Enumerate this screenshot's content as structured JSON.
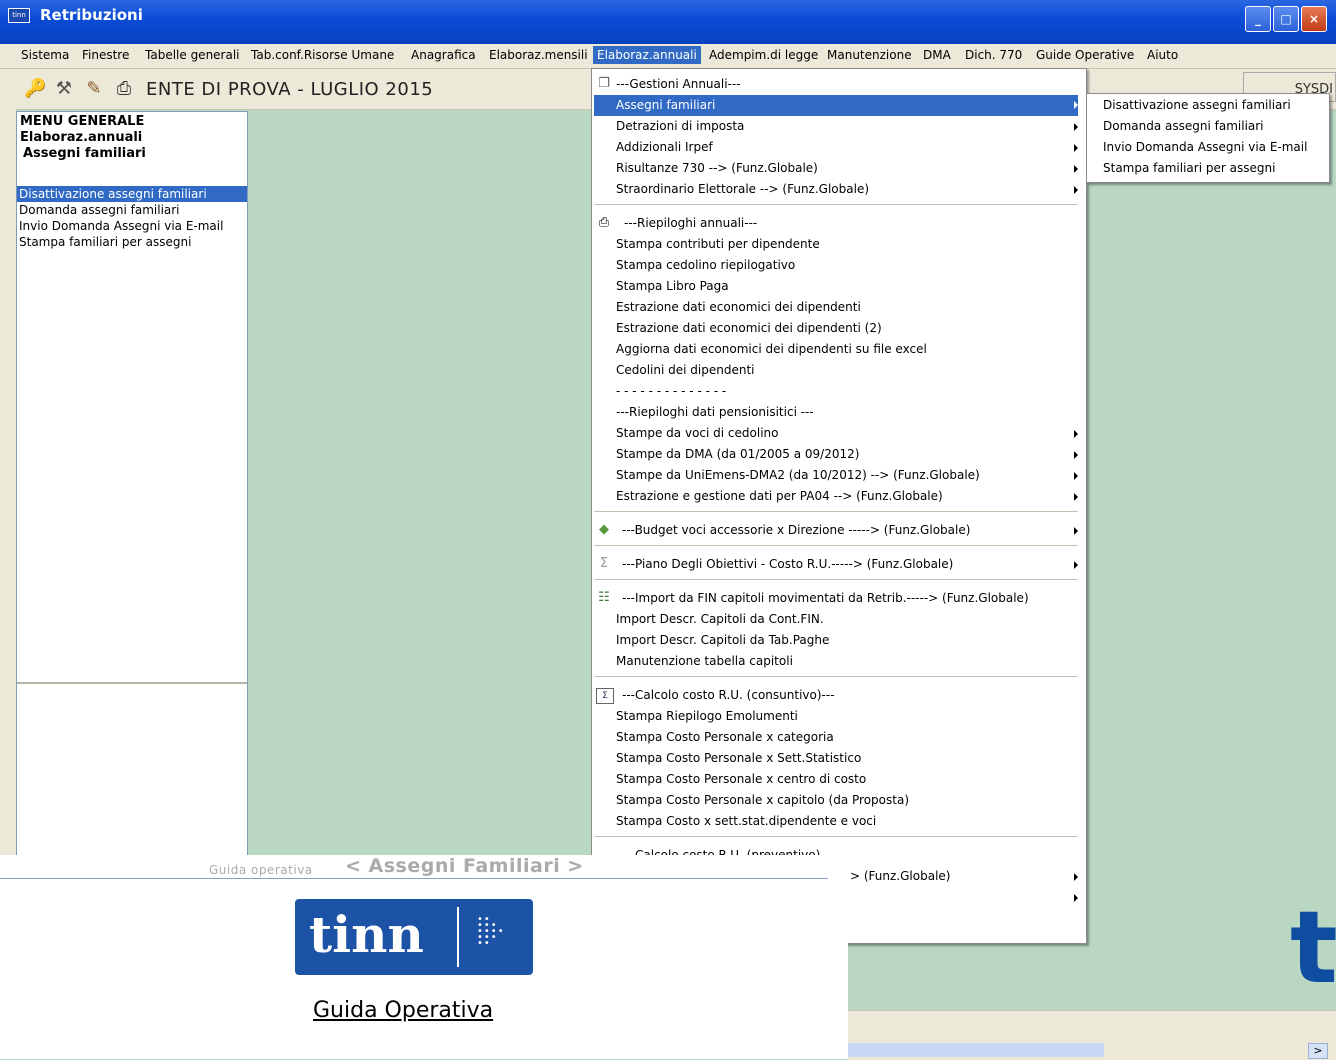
{
  "window": {
    "title": "Retribuzioni",
    "app_icon_text": "tinn",
    "min_label": "_",
    "max_label": "□",
    "close_label": "×"
  },
  "menubar": {
    "items": [
      "Sistema",
      "Finestre",
      "Tabelle generali",
      "Tab.conf.Risorse Umane",
      "Anagrafica",
      "Elaboraz.mensili",
      "Elaboraz.annuali",
      "Adempim.di legge",
      "Manutenzione",
      "DMA",
      "Dich. 770",
      "Guide Operative",
      "Aiuto"
    ]
  },
  "toolbar": {
    "icons": [
      "key-icon",
      "tools-icon",
      "brush-icon",
      "printer-icon"
    ],
    "ente": "ENTE DI PROVA - LUGLIO 2015",
    "sys": "SYSDI"
  },
  "leftpanel": {
    "head1": "MENU GENERALE",
    "head2": "Elaboraz.annuali",
    "head3": "Assegni familiari",
    "items": [
      "Disattivazione assegni familiari",
      "Domanda assegni familiari",
      "Invio Domanda Assegni via E-mail",
      "Stampa familiari per assegni"
    ]
  },
  "menu": {
    "items": [
      "---Gestioni Annuali---",
      "Assegni familiari",
      "Detrazioni di imposta",
      "Addizionali Irpef",
      "Risultanze 730 --> (Funz.Globale)",
      "Straordinario Elettorale --> (Funz.Globale)",
      "---Riepiloghi annuali---",
      "Stampa contributi per dipendente",
      "Stampa cedolino riepilogativo",
      "Stampa Libro Paga",
      "Estrazione dati economici dei dipendenti",
      "Estrazione dati economici dei dipendenti (2)",
      "Aggiorna dati economici dei dipendenti su file excel",
      "Cedolini dei dipendenti",
      "- - - - - - - - - - - - - -",
      "---Riepiloghi dati pensionisitici ---",
      "Stampe da voci di cedolino",
      "Stampe da DMA (da 01/2005 a 09/2012)",
      "Stampe da UniEmens-DMA2 (da 10/2012)  --> (Funz.Globale)",
      "Estrazione e gestione dati per PA04  --> (Funz.Globale)",
      "---Budget voci accessorie x Direzione -----> (Funz.Globale)",
      "---Piano Degli Obiettivi - Costo R.U.-----> (Funz.Globale)",
      "---Import da FIN capitoli movimentati da Retrib.-----> (Funz.Globale)",
      "Import Descr. Capitoli da Cont.FIN.",
      "Import Descr. Capitoli da Tab.Paghe",
      "Manutenzione tabella capitoli",
      "---Calcolo costo R.U. (consuntivo)---",
      "Stampa Riepilogo Emolumenti",
      "Stampa Costo Personale x categoria",
      "Stampa Costo Personale x Sett.Statistico",
      "Stampa Costo Personale x centro di costo",
      "Stampa Costo Personale x capitolo (da Proposta)",
      "Stampa Costo x sett.stat.dipendente e voci",
      "---Calcolo costo R.U. (preventivo)---",
      "> (Funz.Globale)"
    ]
  },
  "submenu": {
    "items": [
      "Disattivazione assegni familiari",
      "Domanda assegni familiari",
      "Invio Domanda Assegni via E-mail",
      "Stampa familiari per assegni"
    ]
  },
  "overlay": {
    "guida_small": "Guida operativa",
    "guida_big": "< Assegni Familiari >",
    "logo_text": "tinn",
    "title": "Guida Operativa"
  },
  "background_letter": "t",
  "status": {
    "scroll_right": ">"
  }
}
